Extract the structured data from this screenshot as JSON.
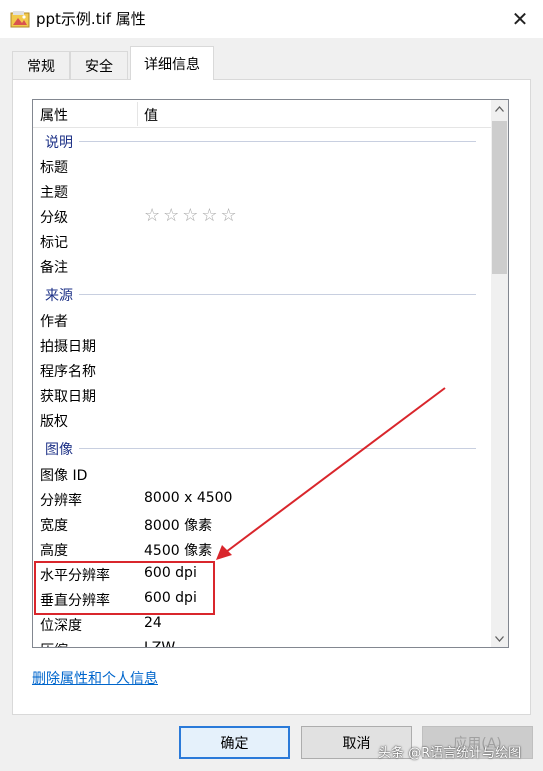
{
  "window": {
    "title": "ppt示例.tif 属性",
    "close_glyph": "✕"
  },
  "tabs": [
    {
      "label": "常规"
    },
    {
      "label": "安全"
    },
    {
      "label": "详细信息",
      "active": true
    }
  ],
  "list": {
    "col_property": "属性",
    "col_value": "值",
    "rows": [
      {
        "type": "group",
        "label": "说明"
      },
      {
        "type": "item",
        "key": "标题",
        "value": ""
      },
      {
        "type": "item",
        "key": "主题",
        "value": ""
      },
      {
        "type": "rating",
        "key": "分级",
        "value": "☆☆☆☆☆",
        "stars": 0
      },
      {
        "type": "item",
        "key": "标记",
        "value": ""
      },
      {
        "type": "item",
        "key": "备注",
        "value": ""
      },
      {
        "type": "group",
        "label": "来源"
      },
      {
        "type": "item",
        "key": "作者",
        "value": ""
      },
      {
        "type": "item",
        "key": "拍摄日期",
        "value": ""
      },
      {
        "type": "item",
        "key": "程序名称",
        "value": ""
      },
      {
        "type": "item",
        "key": "获取日期",
        "value": ""
      },
      {
        "type": "item",
        "key": "版权",
        "value": ""
      },
      {
        "type": "group",
        "label": "图像"
      },
      {
        "type": "item",
        "key": "图像 ID",
        "value": ""
      },
      {
        "type": "item",
        "key": "分辨率",
        "value": "8000 x 4500"
      },
      {
        "type": "item",
        "key": "宽度",
        "value": "8000 像素"
      },
      {
        "type": "item",
        "key": "高度",
        "value": "4500 像素"
      },
      {
        "type": "item",
        "key": "水平分辨率",
        "value": "600 dpi",
        "highlighted": true
      },
      {
        "type": "item",
        "key": "垂直分辨率",
        "value": "600 dpi",
        "highlighted": true
      },
      {
        "type": "item",
        "key": "位深度",
        "value": "24"
      },
      {
        "type": "item",
        "key": "压缩",
        "value": "LZW"
      }
    ]
  },
  "link": {
    "label": "删除属性和个人信息"
  },
  "buttons": {
    "ok": "确定",
    "cancel": "取消",
    "apply": "应用(A)"
  },
  "watermark": "头条 @R语言统计与绘图",
  "colors": {
    "accent": "#2a7ad9",
    "group_label": "#1e3287",
    "link": "#0066cc",
    "annotation": "#d9262c"
  }
}
